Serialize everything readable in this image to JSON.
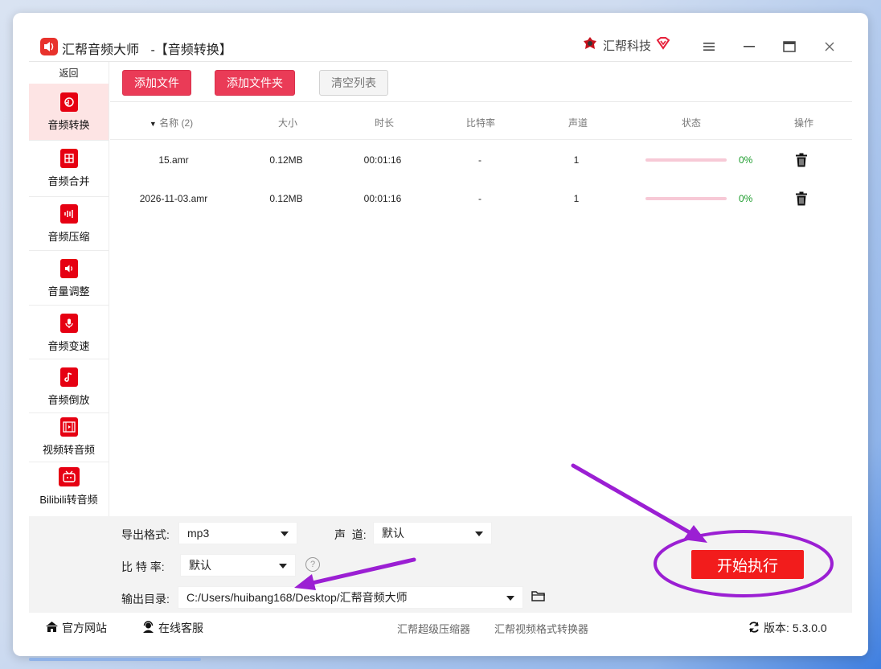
{
  "app": {
    "title": "汇帮音频大师",
    "title_suffix": "-【音频转换】",
    "brand": "汇帮科技"
  },
  "sidebar": {
    "back": "返回",
    "items": [
      {
        "label": "音频转换",
        "active": true
      },
      {
        "label": "音频合并"
      },
      {
        "label": "音频压缩"
      },
      {
        "label": "音量调整"
      },
      {
        "label": "音频变速"
      },
      {
        "label": "音频倒放"
      },
      {
        "label": "视频转音频"
      },
      {
        "label": "Bilibili转音频"
      }
    ]
  },
  "toolbar": {
    "add_file": "添加文件",
    "add_folder": "添加文件夹",
    "clear_list": "清空列表"
  },
  "table": {
    "headers": {
      "name": "名称",
      "name_count": "(2)",
      "size": "大小",
      "duration": "时长",
      "bitrate": "比特率",
      "channel": "声道",
      "status": "状态",
      "action": "操作"
    },
    "rows": [
      {
        "name": "15.amr",
        "size": "0.12MB",
        "duration": "00:01:16",
        "bitrate": "-",
        "channel": "1",
        "progress": 0,
        "percent": "0%"
      },
      {
        "name": "2026-11-03.amr",
        "size": "0.12MB",
        "duration": "00:01:16",
        "bitrate": "-",
        "channel": "1",
        "progress": 0,
        "percent": "0%"
      }
    ]
  },
  "settings": {
    "format_label": "导出格式:",
    "format_value": "mp3",
    "channel_label": "声  道:",
    "channel_value": "默认",
    "bitrate_label": "比 特 率:",
    "bitrate_value": "默认",
    "output_label": "输出目录:",
    "output_value": "C:/Users/huibang168/Desktop/汇帮音频大师",
    "help": "?",
    "start": "开始执行"
  },
  "footer": {
    "website": "官方网站",
    "support": "在线客服",
    "compressor": "汇帮超级压缩器",
    "converter": "汇帮视频格式转换器",
    "version_label": "版本:",
    "version": "5.3.0.0"
  },
  "colors": {
    "accent": "#ea3b57",
    "start": "#f21c1c",
    "annotation": "#9b1fd3",
    "progress_track": "#f7c9d6",
    "percent": "#1a9b2a"
  }
}
